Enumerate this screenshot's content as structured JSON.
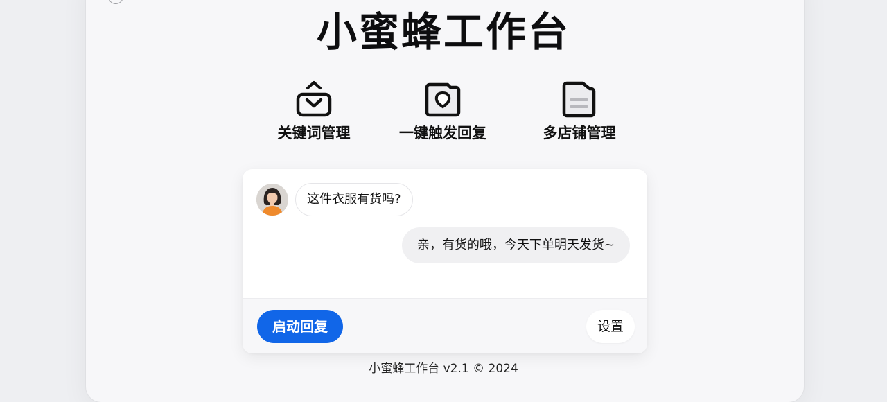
{
  "app": {
    "title": "小蜜蜂工作台",
    "footer": "小蜜蜂工作台 v2.1 © 2024"
  },
  "features": [
    {
      "label": "关键词管理",
      "icon": "inbox-tray-icon"
    },
    {
      "label": "一键触发回复",
      "icon": "camera-icon"
    },
    {
      "label": "多店铺管理",
      "icon": "folder-document-icon"
    }
  ],
  "chat": {
    "incoming": "这件衣服有货吗?",
    "outgoing": "亲，有货的哦，今天下单明天发货~",
    "avatar_icon": "customer-avatar"
  },
  "actions": {
    "start_label": "启动回复",
    "settings_label": "设置"
  },
  "colors": {
    "accent": "#1166e8",
    "background": "#eeeff2",
    "card": "#ffffff"
  }
}
